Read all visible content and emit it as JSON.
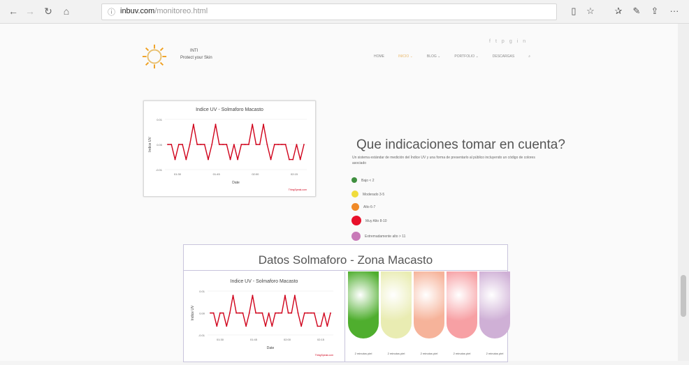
{
  "browser": {
    "url_host": "inbuv.com",
    "url_path": "/monitoreo.html",
    "icons": [
      "back-arrow-icon",
      "forward-arrow-icon",
      "refresh-icon",
      "home-icon",
      "info-icon",
      "reader-icon",
      "favorite-star-icon",
      "favorites-icon",
      "pen-icon",
      "share-icon",
      "more-icon"
    ]
  },
  "header": {
    "brand_line1": "INTI",
    "brand_line2": "Protect your Skin",
    "menu": [
      "HOME",
      "INICIO",
      "BLOG",
      "PORTFOLIO",
      "DESCARGAS"
    ],
    "active_index": 1,
    "social_icons": [
      "f",
      "t",
      "p",
      "g",
      "in"
    ]
  },
  "top_chart": {
    "title": "Indice UV - Solmaforo Macasto",
    "ylabel": "Indice UV",
    "xlabel": "Date",
    "source": "ThingSpeak.com"
  },
  "indications": {
    "title": "Que indicaciones tomar en cuenta?",
    "desc": "Un sistema estándar de medición del Índice UV y una forma de presentarlo al público incluyendo un código de colores asociado",
    "items": [
      {
        "label": "Bajo < 2",
        "color": "#3f8f3f"
      },
      {
        "label": "Moderado 3-5",
        "color": "#f0dc3c"
      },
      {
        "label": "Alto 6-7",
        "color": "#f08a28"
      },
      {
        "label": "Muy Alto 8-10",
        "color": "#e8102a"
      },
      {
        "label": "Extremadamente alto > 11",
        "color": "#c87ab8"
      }
    ]
  },
  "datos": {
    "title": "Datos Solmaforo - Zona Macasto",
    "ball_labels": [
      "2 minutos piel",
      "2 minutos piel",
      "2 minutos piel",
      "2 minutos piel",
      "2 minutos piel"
    ],
    "ball_colors": [
      "#4fae2e",
      "#e9ecb2",
      "#f6b39a",
      "#f7a0a4",
      "#cfb0d6"
    ]
  },
  "chart_data": [
    {
      "type": "line",
      "title": "Indice UV - Solmaforo Macasto",
      "xlabel": "Date",
      "ylabel": "Indice UV",
      "x_ticks": [
        "01:30",
        "01:45",
        "02:00",
        "02:15"
      ],
      "y_ticks": [
        "0.01",
        "0.00",
        "-0.01"
      ],
      "ylim": [
        -0.01,
        0.01
      ],
      "series": [
        {
          "color": "#d0021b",
          "values": [
            0,
            0,
            -0.006,
            0,
            0,
            -0.006,
            0,
            0.008,
            0,
            0,
            0,
            -0.006,
            0,
            0.008,
            0,
            0,
            0,
            -0.006,
            0,
            -0.006,
            0,
            0,
            0,
            0.008,
            0,
            0,
            0.008,
            0,
            -0.006,
            0,
            0,
            0,
            0,
            -0.006,
            -0.006,
            0,
            -0.006,
            0
          ]
        }
      ]
    }
  ]
}
